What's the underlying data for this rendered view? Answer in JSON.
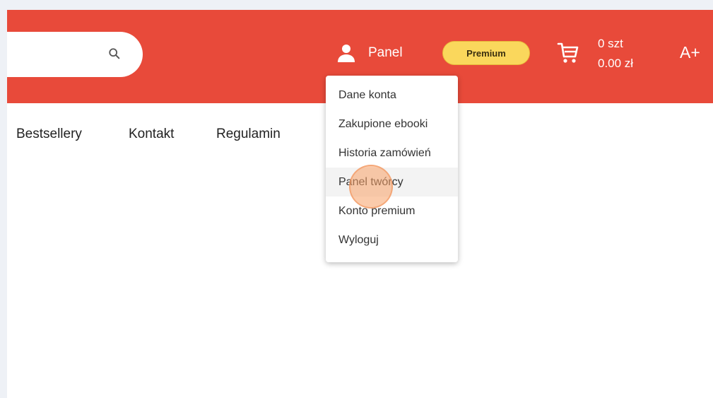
{
  "header": {
    "search": {
      "placeholder": "",
      "icon": "search-icon"
    },
    "user": {
      "icon": "user-icon",
      "label": "Panel"
    },
    "premium_badge": "Premium",
    "cart": {
      "icon": "cart-icon",
      "count": "0 szt",
      "total": "0.00 zł"
    },
    "font_size_toggle": "A+"
  },
  "nav": {
    "items": [
      {
        "label": "Bestsellery"
      },
      {
        "label": "Kontakt"
      },
      {
        "label": "Regulamin"
      }
    ]
  },
  "user_menu": {
    "items": [
      {
        "label": "Dane konta"
      },
      {
        "label": "Zakupione ebooki"
      },
      {
        "label": "Historia zamówień"
      },
      {
        "label": "Panel twórcy",
        "hovered": true
      },
      {
        "label": "Konto premium"
      },
      {
        "label": "Wyloguj"
      }
    ]
  },
  "colors": {
    "header_bg": "#e84a3a",
    "premium_bg": "#fad75c",
    "page_bg": "#ffffff",
    "outer_bg": "#eef1f6",
    "click_marker": "#f7a066"
  }
}
